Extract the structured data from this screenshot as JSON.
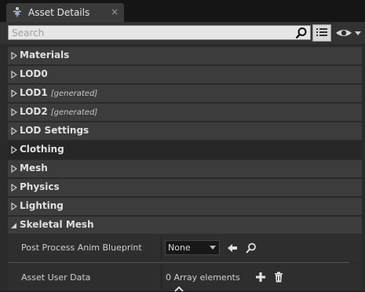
{
  "tab": {
    "title": "Asset Details",
    "close": "×"
  },
  "search": {
    "placeholder": "Search",
    "value": ""
  },
  "categories": [
    {
      "label": "Materials",
      "generated": ""
    },
    {
      "label": "LOD0",
      "generated": ""
    },
    {
      "label": "LOD1",
      "generated": "[generated]"
    },
    {
      "label": "LOD2",
      "generated": "[generated]"
    },
    {
      "label": "LOD Settings",
      "generated": ""
    },
    {
      "label": "Clothing",
      "generated": ""
    },
    {
      "label": "Mesh",
      "generated": ""
    },
    {
      "label": "Physics",
      "generated": ""
    },
    {
      "label": "Lighting",
      "generated": ""
    },
    {
      "label": "Skeletal Mesh",
      "generated": ""
    }
  ],
  "properties": {
    "post_process": {
      "name": "Post Process Anim Blueprint",
      "value": "None"
    },
    "asset_user_data": {
      "name": "Asset User Data",
      "value": "0 Array elements"
    }
  },
  "colors": {
    "panel_bg": "#2a2a2a",
    "category_bg": "#3c3c3c",
    "search_bg": "#e6e6e6"
  }
}
